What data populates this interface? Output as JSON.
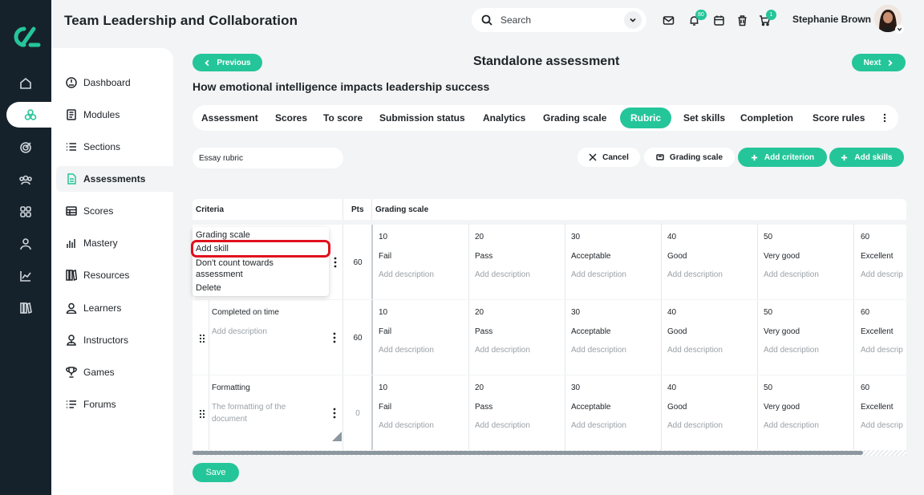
{
  "app": {
    "title": "Team Leadership and Collaboration"
  },
  "header": {
    "search_placeholder": "Search",
    "notifications_count": "80",
    "cart_count": "1",
    "user_name": "Stephanie Brown"
  },
  "sidebar": {
    "items": [
      {
        "label": "Dashboard",
        "icon": "speedometer-icon"
      },
      {
        "label": "Modules",
        "icon": "book-icon"
      },
      {
        "label": "Sections",
        "icon": "list-icon"
      },
      {
        "label": "Assessments",
        "icon": "document-icon"
      },
      {
        "label": "Scores",
        "icon": "table-icon"
      },
      {
        "label": "Mastery",
        "icon": "bar-chart-icon"
      },
      {
        "label": "Resources",
        "icon": "library-icon"
      },
      {
        "label": "Learners",
        "icon": "user-icon"
      },
      {
        "label": "Instructors",
        "icon": "instructor-icon"
      },
      {
        "label": "Games",
        "icon": "trophy-icon"
      },
      {
        "label": "Forums",
        "icon": "forum-icon"
      }
    ],
    "active": "Assessments"
  },
  "nav": {
    "previous_label": "Previous",
    "next_label": "Next"
  },
  "page": {
    "title": "Standalone assessment",
    "subtitle": "How emotional intelligence impacts leadership success"
  },
  "tabs": [
    "Assessment",
    "Scores",
    "To score",
    "Submission status",
    "Analytics",
    "Grading scale",
    "Rubric",
    "Set skills",
    "Completion",
    "Score rules"
  ],
  "active_tab": "Rubric",
  "rubric": {
    "name_value": "Essay rubric",
    "cancel_label": "Cancel",
    "grading_scale_label": "Grading scale",
    "add_criterion_label": "Add criterion",
    "add_skills_label": "Add skills",
    "save_label": "Save"
  },
  "table": {
    "headers": {
      "criteria": "Criteria",
      "pts": "Pts",
      "grading_scale": "Grading scale"
    },
    "scale": [
      {
        "points": "10",
        "label": "Fail"
      },
      {
        "points": "20",
        "label": "Pass"
      },
      {
        "points": "30",
        "label": "Acceptable"
      },
      {
        "points": "40",
        "label": "Good"
      },
      {
        "points": "50",
        "label": "Very good"
      },
      {
        "points": "60",
        "label": "Excellent"
      }
    ],
    "add_description": "Add description",
    "add_description_truncated": "Add descrip",
    "rows": [
      {
        "name": "",
        "description": "",
        "pts": "60"
      },
      {
        "name": "Completed on time",
        "description": "Add description",
        "pts": "60"
      },
      {
        "name": "Formatting",
        "description": "The formatting of the document",
        "pts": "0"
      }
    ]
  },
  "context_menu": {
    "items": [
      "Grading scale",
      "Add skill",
      "Don't count towards assessment",
      "Delete"
    ],
    "highlighted": "Add skill"
  },
  "colors": {
    "accent": "#25c59a",
    "rail": "#16222b",
    "highlight": "#e0111c"
  }
}
